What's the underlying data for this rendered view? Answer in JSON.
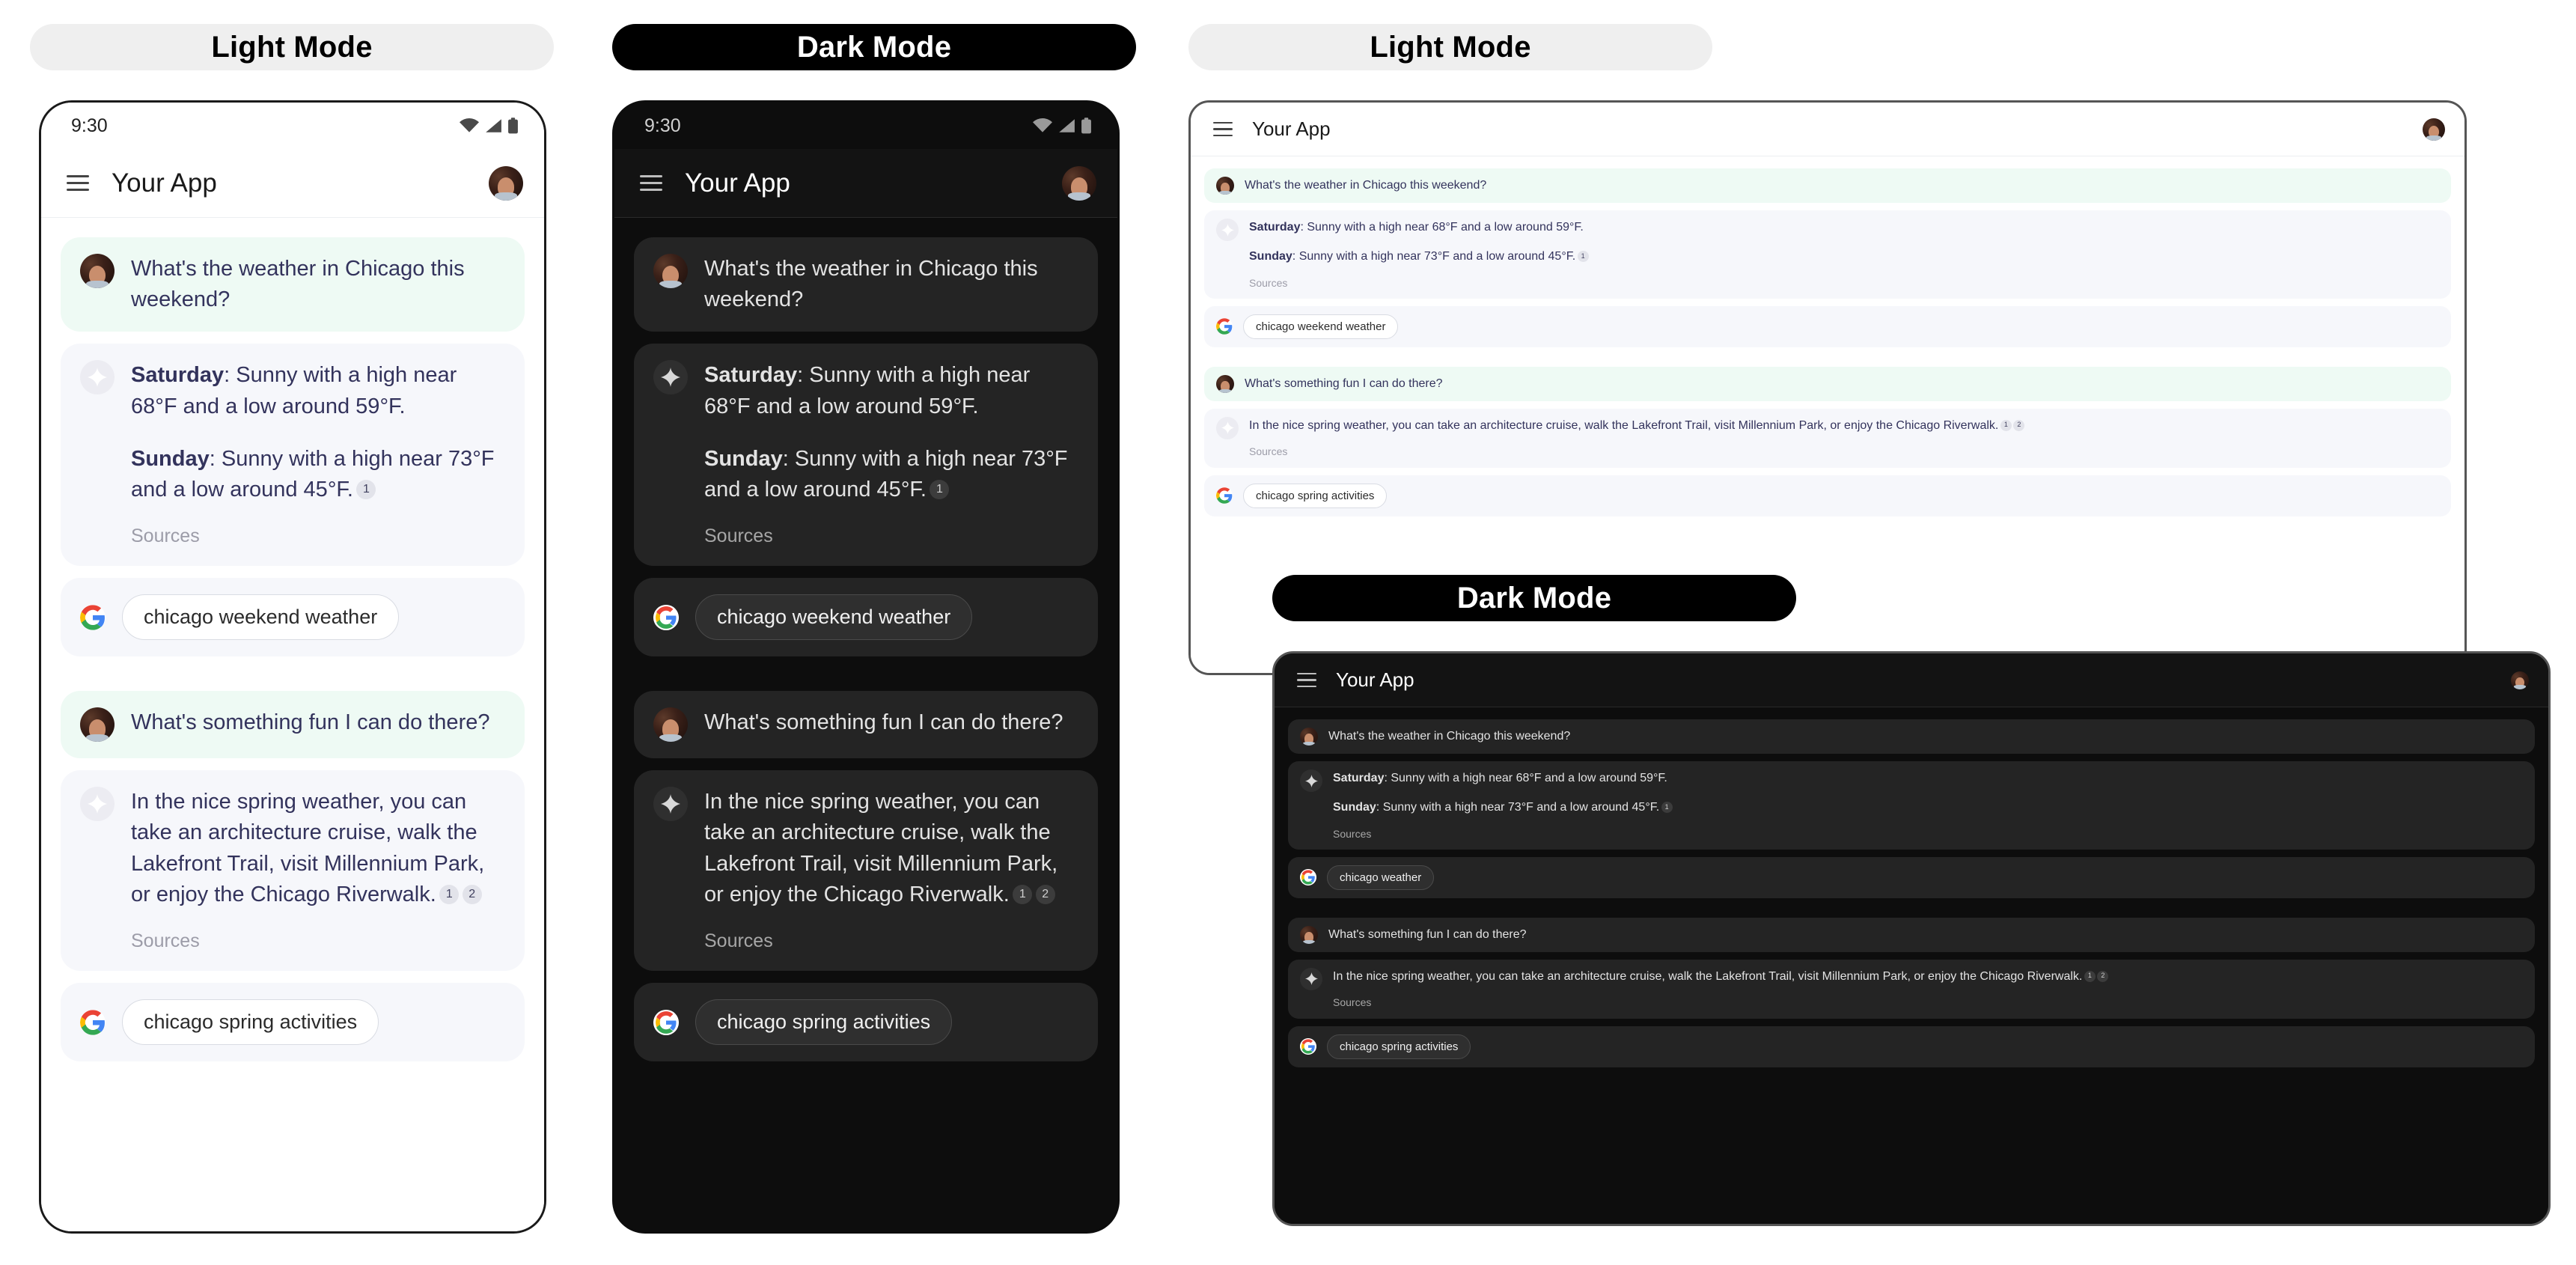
{
  "labels": {
    "light_mode": "Light Mode",
    "dark_mode": "Dark Mode"
  },
  "status_bar": {
    "time": "9:30",
    "icons": [
      "wifi-icon",
      "cell-signal-icon",
      "battery-icon"
    ]
  },
  "app_bar": {
    "menu_icon": "hamburger-menu-icon",
    "title": "Your App",
    "avatar": "user-avatar"
  },
  "conversation": {
    "messages": [
      {
        "role": "user",
        "text": "What's the weather in Chicago this weekend?"
      },
      {
        "role": "assistant",
        "line1_label": "Saturday",
        "line1_text": ": Sunny with a high near 68°F and a low around 59°F.",
        "line2_label": "Sunday",
        "line2_text": ": Sunny with a high near 73°F and a low around 45°F.",
        "citations": [
          "1"
        ],
        "sources_label": "Sources"
      },
      {
        "role": "search-chip",
        "logo": "google-logo-icon",
        "query": "chicago weekend weather"
      },
      {
        "role": "user",
        "text": "What's something fun I can do there?"
      },
      {
        "role": "assistant",
        "text": "In the nice spring weather, you can take an architecture cruise, walk the Lakefront Trail, visit Millennium Park, or enjoy the Chicago Riverwalk.",
        "citations": [
          "1",
          "2"
        ],
        "sources_label": "Sources"
      },
      {
        "role": "search-chip",
        "logo": "google-logo-icon",
        "query": "chicago spring activities"
      }
    ],
    "tablet_dark_first_query": "chicago weather"
  },
  "colors": {
    "light_panel_bg": "#ffffff",
    "dark_panel_bg": "#0d0d0d",
    "user_bubble_light": "#eefaf4",
    "bot_bubble_light": "#f6f7fb",
    "bubble_dark": "#242424",
    "text_light": "#33335c",
    "text_dark": "#e3e3e3",
    "pill_light_bg": "#efefef",
    "pill_dark_bg": "#000000",
    "google_blue": "#4285F4",
    "google_red": "#EA4335",
    "google_yellow": "#FBBC05",
    "google_green": "#34A853"
  }
}
